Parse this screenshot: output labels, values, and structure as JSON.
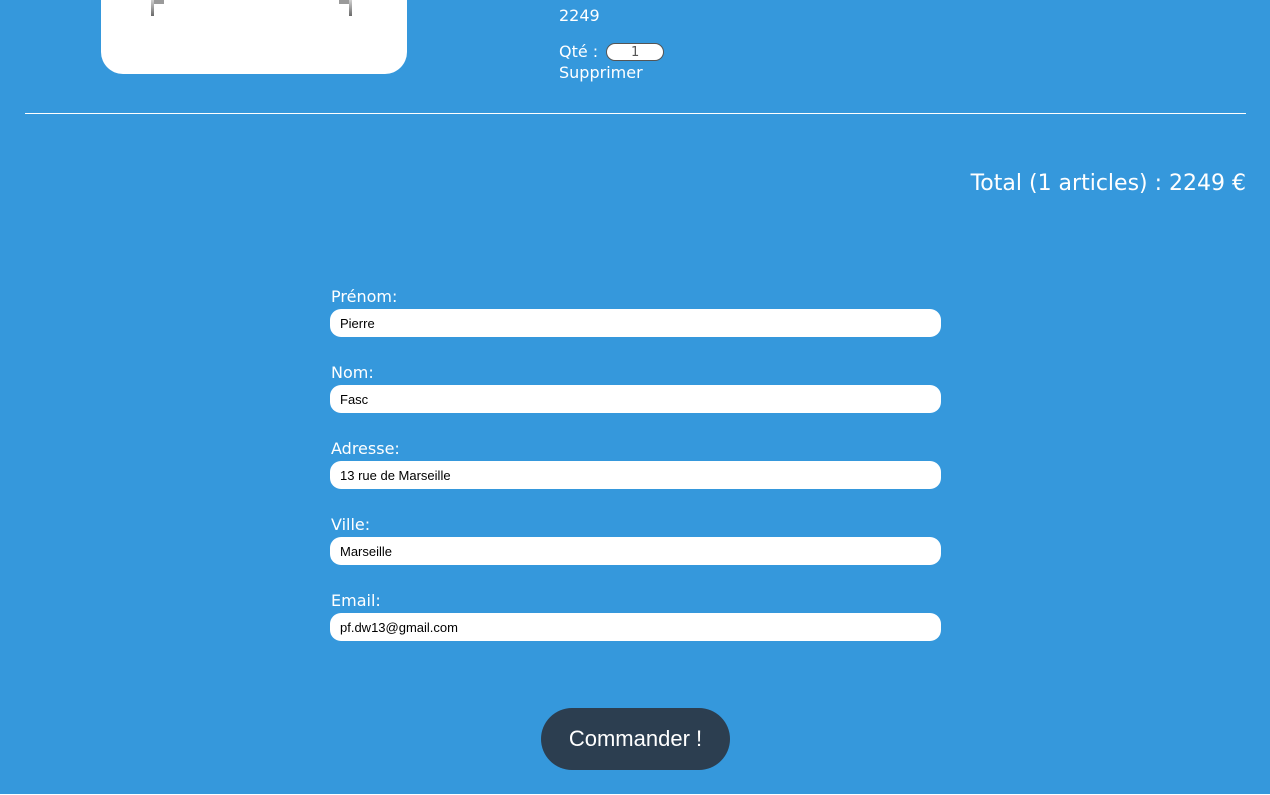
{
  "cart": {
    "item": {
      "price": "2249",
      "quantity_label": "Qté :",
      "quantity_value": "1",
      "remove_label": "Supprimer"
    },
    "total": "Total (1 articles) : 2249 €"
  },
  "form": {
    "fields": [
      {
        "label": "Prénom:",
        "value": "Pierre"
      },
      {
        "label": "Nom:",
        "value": "Fasc"
      },
      {
        "label": "Adresse:",
        "value": "13 rue de Marseille"
      },
      {
        "label": "Ville:",
        "value": "Marseille"
      },
      {
        "label": "Email:",
        "value": "pf.dw13@gmail.com"
      }
    ],
    "submit_label": "Commander !"
  },
  "colors": {
    "background": "#3598dc",
    "button": "#2c3e50",
    "text": "#ffffff"
  }
}
